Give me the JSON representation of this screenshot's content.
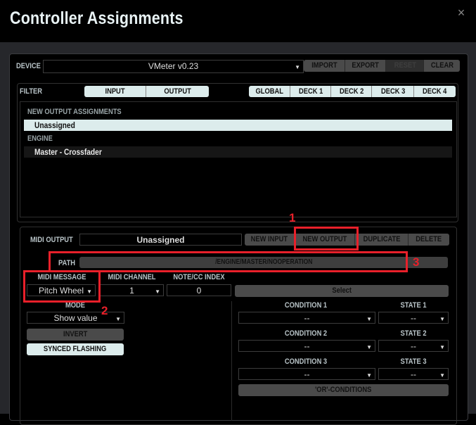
{
  "window": {
    "title": "Controller Assignments",
    "close_icon": "×"
  },
  "device": {
    "label": "DEVICE",
    "selected": "VMeter v0.23",
    "buttons": [
      {
        "label": "IMPORT",
        "enabled": true
      },
      {
        "label": "EXPORT",
        "enabled": true
      },
      {
        "label": "RESET",
        "enabled": false
      },
      {
        "label": "CLEAR",
        "enabled": true
      }
    ]
  },
  "filter": {
    "label": "FILTER",
    "io_tabs": [
      "INPUT",
      "OUTPUT"
    ],
    "scope_tabs": [
      "GLOBAL",
      "DECK 1",
      "DECK 2",
      "DECK 3",
      "DECK 4"
    ]
  },
  "assignments": {
    "groups": [
      {
        "header": "NEW OUTPUT ASSIGNMENTS",
        "items": [
          {
            "label": "Unassigned",
            "selected": true
          }
        ]
      },
      {
        "header": "ENGINE",
        "items": [
          {
            "label": "Master - Crossfader",
            "selected": false
          }
        ]
      }
    ]
  },
  "editor": {
    "midi_output_label": "MIDI OUTPUT",
    "midi_output_value": "Unassigned",
    "actions": [
      "NEW INPUT",
      "NEW OUTPUT",
      "DUPLICATE",
      "DELETE"
    ],
    "path_label": "PATH",
    "path_value": "/ENGINE/MASTER/NOOPERATION",
    "midi_message_label": "MIDI MESSAGE",
    "midi_message_value": "Pitch Wheel",
    "midi_channel_label": "MIDI CHANNEL",
    "midi_channel_value": "1",
    "note_cc_label": "NOTE/CC INDEX",
    "note_cc_value": "0",
    "select_label": "Select",
    "mode_label": "MODE",
    "mode_value": "Show value",
    "invert_label": "INVERT",
    "synced_flashing_label": "SYNCED FLASHING",
    "conditions": [
      {
        "condition_label": "CONDITION 1",
        "condition_value": "--",
        "state_label": "STATE 1",
        "state_value": "--"
      },
      {
        "condition_label": "CONDITION 2",
        "condition_value": "--",
        "state_label": "STATE 2",
        "state_value": "--"
      },
      {
        "condition_label": "CONDITION 3",
        "condition_value": "--",
        "state_label": "STATE 3",
        "state_value": "--"
      }
    ],
    "or_conditions_label": "'OR'-CONDITIONS"
  },
  "annotations": {
    "n1": "1",
    "n2": "2",
    "n3": "3",
    "color": "#e8202a"
  }
}
